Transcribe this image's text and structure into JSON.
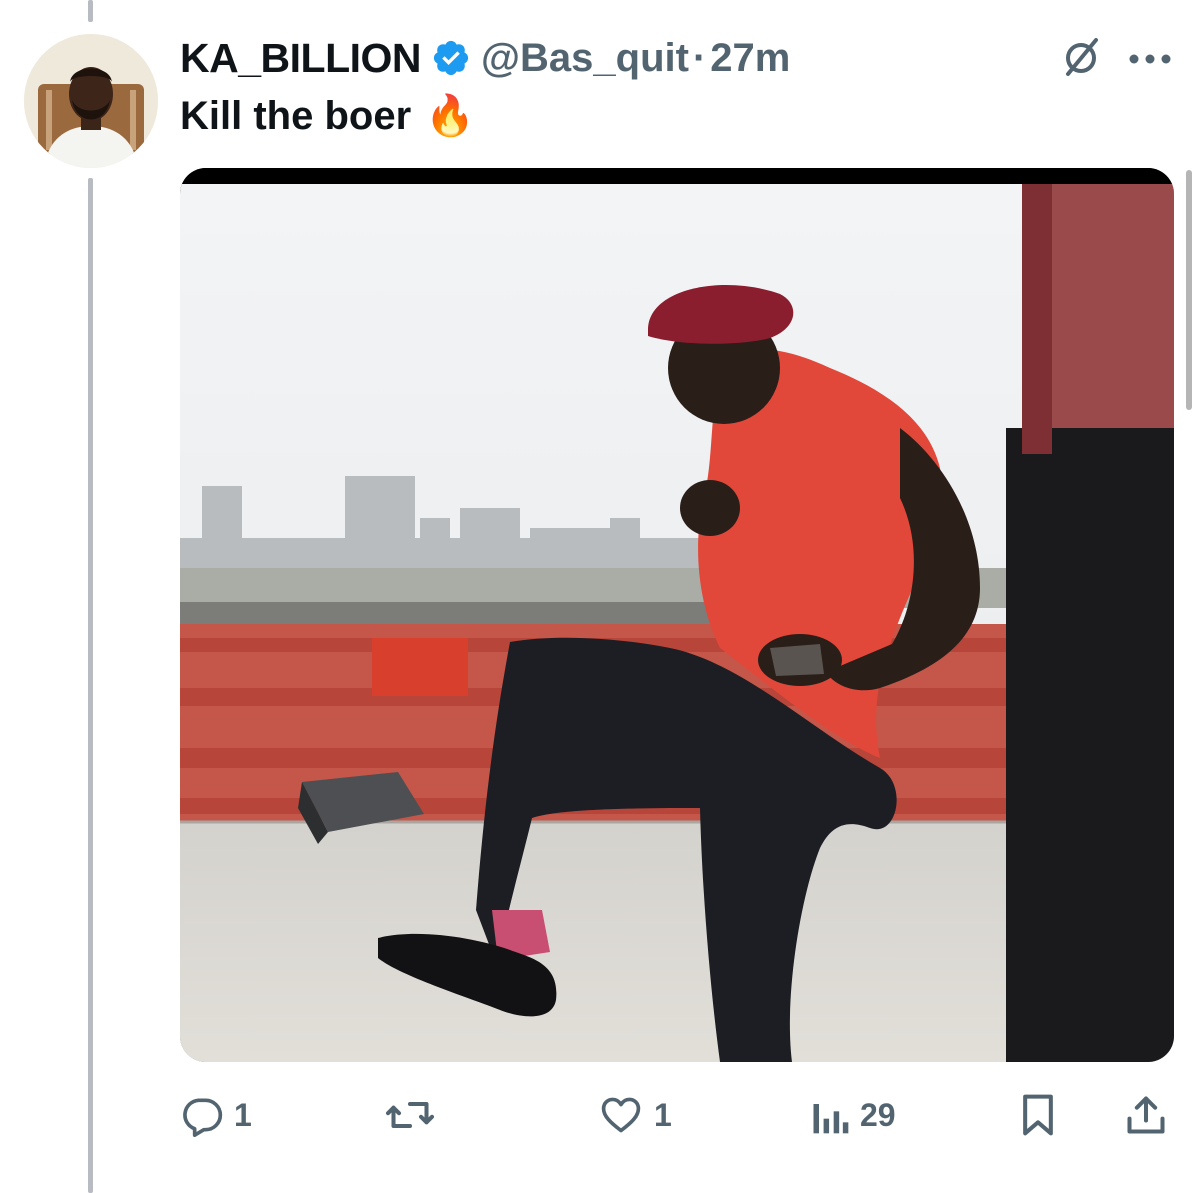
{
  "tweet": {
    "display_name": "KA_BILLION",
    "handle": "@Bas_quit",
    "separator": "·",
    "time": "27m",
    "text": "Kill the boer",
    "emoji": "🔥",
    "verified_color": "#1d9bf0"
  },
  "actions": {
    "replies": "1",
    "retweets": "",
    "likes": "1",
    "views": "29"
  },
  "icons": {
    "header": [
      "grok-icon",
      "more-icon"
    ],
    "action_bar": [
      "reply-icon",
      "retweet-icon",
      "like-icon",
      "views-icon",
      "bookmark-icon",
      "share-icon"
    ]
  },
  "colors": {
    "text_primary": "#0f1419",
    "text_secondary": "#536471",
    "thread_line": "#b8bcc2"
  }
}
